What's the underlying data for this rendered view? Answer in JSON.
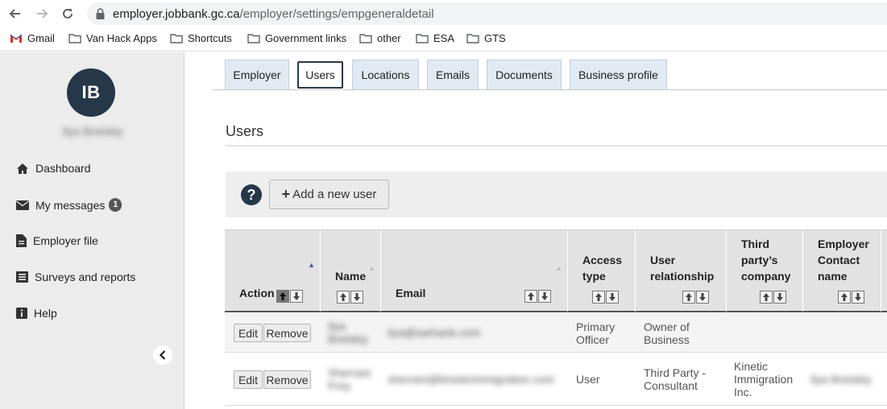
{
  "browser": {
    "url_host": "employer.jobbank.gc.ca",
    "url_path": "/employer/settings/empgeneraldetail",
    "bookmarks": [
      {
        "label": "Gmail",
        "icon": "gmail-icon"
      },
      {
        "label": "Van Hack Apps",
        "icon": "folder-icon"
      },
      {
        "label": "Shortcuts",
        "icon": "folder-icon"
      },
      {
        "label": "Government links",
        "icon": "folder-icon"
      },
      {
        "label": "other",
        "icon": "folder-icon"
      },
      {
        "label": "ESA",
        "icon": "folder-icon"
      },
      {
        "label": "GTS",
        "icon": "folder-icon"
      }
    ]
  },
  "sidebar": {
    "avatar_initials": "IB",
    "user_name": "Ilya Bretskiy",
    "items": [
      {
        "label": "Dashboard",
        "icon": "home-icon"
      },
      {
        "label": "My messages",
        "icon": "envelope-icon",
        "badge": "1"
      },
      {
        "label": "Employer file",
        "icon": "file-icon"
      },
      {
        "label": "Surveys and reports",
        "icon": "list-icon"
      },
      {
        "label": "Help",
        "icon": "info-icon"
      }
    ]
  },
  "tabs": [
    {
      "label": "Employer",
      "active": false
    },
    {
      "label": "Users",
      "active": true
    },
    {
      "label": "Locations",
      "active": false
    },
    {
      "label": "Emails",
      "active": false
    },
    {
      "label": "Documents",
      "active": false
    },
    {
      "label": "Business profile",
      "active": false
    }
  ],
  "section": {
    "title": "Users",
    "add_user_label": "Add a new user",
    "help_label": "?"
  },
  "table": {
    "columns": [
      {
        "label": "Action"
      },
      {
        "label": "Name"
      },
      {
        "label": "Email"
      },
      {
        "label": "Access type"
      },
      {
        "label": "User relationship"
      },
      {
        "label": "Third party’s company"
      },
      {
        "label": "Employer Contact name"
      }
    ],
    "edit_label": "Edit",
    "remove_label": "Remove",
    "rows": [
      {
        "name": "Ilya Bretskiy",
        "email": "ilya@sarhank.com",
        "access_type": "Primary Officer",
        "relationship": "Owner of Business",
        "third_party_company": "",
        "contact_name": ""
      },
      {
        "name": "Sherrani Frey",
        "email": "sherrani@kineticimmigration.com",
        "access_type": "User",
        "relationship": "Third Party - Consultant",
        "third_party_company": "Kinetic Immigration Inc.",
        "contact_name": "Ilya Bretskiy"
      }
    ]
  },
  "colors": {
    "accent": "#26374a",
    "sidebar_bg": "#ececec",
    "tab_bg": "#e1eaf2",
    "table_header_bg": "#e2e2e2"
  }
}
